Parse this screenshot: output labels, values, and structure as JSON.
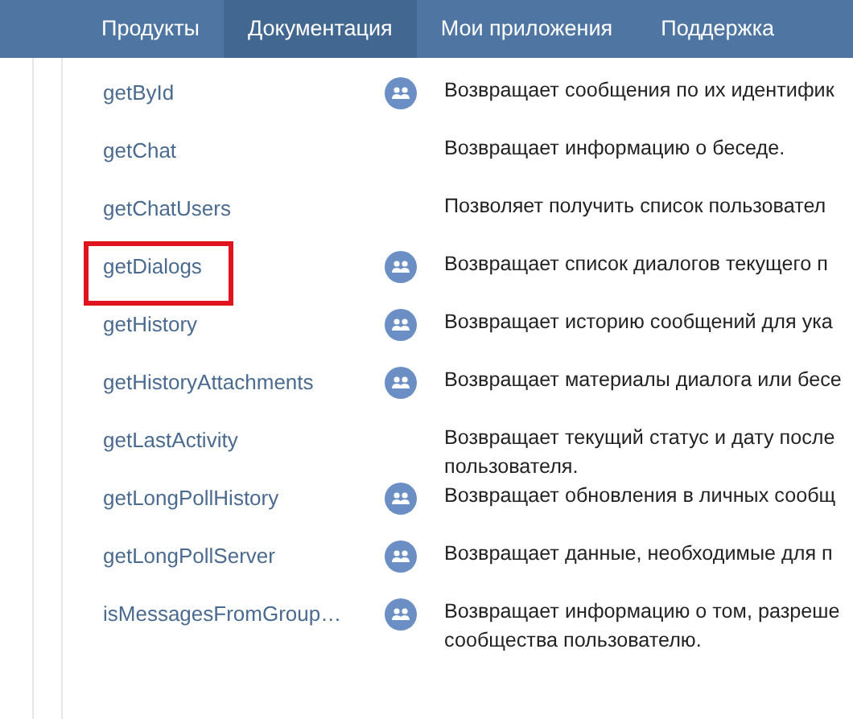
{
  "nav": {
    "tabs": [
      {
        "label": "Продукты",
        "selected": false
      },
      {
        "label": "Документация",
        "selected": true
      },
      {
        "label": "Мои приложения",
        "selected": false
      },
      {
        "label": "Поддержка",
        "selected": false
      }
    ]
  },
  "methods": [
    {
      "name": "getById",
      "group_access": true,
      "highlighted": false,
      "description": [
        "Возвращает сообщения по их идентифик"
      ]
    },
    {
      "name": "getChat",
      "group_access": false,
      "highlighted": false,
      "description": [
        "Возвращает информацию о беседе."
      ]
    },
    {
      "name": "getChatUsers",
      "group_access": false,
      "highlighted": false,
      "description": [
        "Позволяет получить список пользовател"
      ]
    },
    {
      "name": "getDialogs",
      "group_access": true,
      "highlighted": true,
      "description": [
        "Возвращает список диалогов текущего п"
      ]
    },
    {
      "name": "getHistory",
      "group_access": true,
      "highlighted": false,
      "description": [
        "Возвращает историю сообщений для ука"
      ]
    },
    {
      "name": "getHistoryAttachments",
      "group_access": true,
      "highlighted": false,
      "description": [
        "Возвращает материалы диалога или бесе"
      ]
    },
    {
      "name": "getLastActivity",
      "group_access": false,
      "highlighted": false,
      "description": [
        "Возвращает текущий статус и дату после",
        "пользователя."
      ]
    },
    {
      "name": "getLongPollHistory",
      "group_access": true,
      "highlighted": false,
      "description": [
        "Возвращает обновления в личных сообщ"
      ]
    },
    {
      "name": "getLongPollServer",
      "group_access": true,
      "highlighted": false,
      "description": [
        "Возвращает данные, необходимые для п"
      ]
    },
    {
      "name": "isMessagesFromGroup…",
      "group_access": true,
      "highlighted": false,
      "description": [
        "Возвращает информацию о том, разреше",
        "сообщества пользователю."
      ]
    }
  ]
}
